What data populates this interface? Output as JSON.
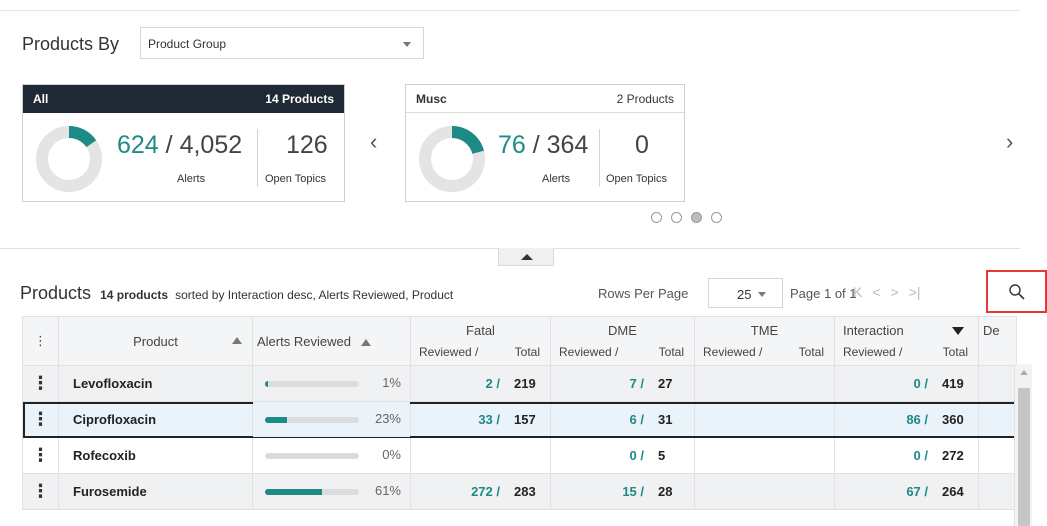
{
  "products_by": {
    "label": "Products By",
    "select_value": "Product Group"
  },
  "cards": [
    {
      "name": "All",
      "products": "14 Products",
      "alerts_reviewed": "624",
      "alerts_total": "4,052",
      "alerts_label": "Alerts",
      "open_topics": "126",
      "open_topics_label": "Open Topics",
      "donut_fraction": 0.154
    },
    {
      "name": "Musc",
      "products": "2 Products",
      "alerts_reviewed": "76",
      "alerts_total": "364",
      "alerts_label": "Alerts",
      "open_topics": "0",
      "open_topics_label": "Open Topics",
      "donut_fraction": 0.209
    }
  ],
  "carousel": {
    "prev": "‹",
    "next": "›",
    "pages": 4,
    "active_page": 3
  },
  "products_header": {
    "title": "Products",
    "count": "14 products",
    "sort_info": "sorted by Interaction desc, Alerts Reviewed, Product",
    "rows_per_page_label": "Rows Per Page",
    "rows_per_page": "25",
    "page_info": "Page 1 of 1"
  },
  "table": {
    "headers": {
      "product": "Product",
      "alerts_reviewed": "Alerts Reviewed",
      "fatal": "Fatal",
      "dme": "DME",
      "tme": "TME",
      "interaction": "Interaction",
      "reviewed": "Reviewed /",
      "total": "Total",
      "extra": "De"
    },
    "rows": [
      {
        "product": "Levofloxacin",
        "alerts_pct": "1%",
        "alerts_frac": 0.01,
        "fatal_rev": "2 /",
        "fatal_tot": "219",
        "dme_rev": "7 /",
        "dme_tot": "27",
        "tme_rev": "",
        "tme_tot": "",
        "int_rev": "0 /",
        "int_tot": "419"
      },
      {
        "product": "Ciprofloxacin",
        "alerts_pct": "23%",
        "alerts_frac": 0.23,
        "fatal_rev": "33 /",
        "fatal_tot": "157",
        "dme_rev": "6 /",
        "dme_tot": "31",
        "tme_rev": "",
        "tme_tot": "",
        "int_rev": "86 /",
        "int_tot": "360"
      },
      {
        "product": "Rofecoxib",
        "alerts_pct": "0%",
        "alerts_frac": 0.0,
        "fatal_rev": "",
        "fatal_tot": "",
        "dme_rev": "0 /",
        "dme_tot": "5",
        "tme_rev": "",
        "tme_tot": "",
        "int_rev": "0 /",
        "int_tot": "272"
      },
      {
        "product": "Furosemide",
        "alerts_pct": "61%",
        "alerts_frac": 0.61,
        "fatal_rev": "272 /",
        "fatal_tot": "283",
        "dme_rev": "15 /",
        "dme_tot": "28",
        "tme_rev": "",
        "tme_tot": "",
        "int_rev": "67 /",
        "int_tot": "264"
      }
    ]
  },
  "colors": {
    "accent": "#1d8a86",
    "card_dark": "#1f2a36",
    "highlight_border": "#e53935"
  }
}
